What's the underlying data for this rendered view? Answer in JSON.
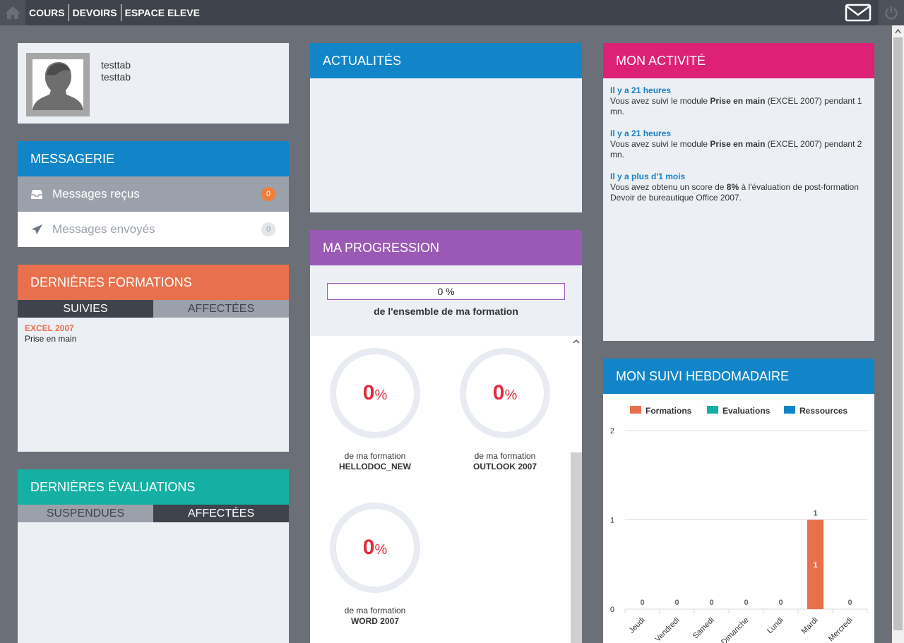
{
  "nav": {
    "items": [
      "COURS",
      "DEVOIRS",
      "ESPACE ELEVE"
    ]
  },
  "profile": {
    "line1": "testtab",
    "line2": "testtab"
  },
  "messagerie": {
    "title": "MESSAGERIE",
    "received_label": "Messages reçus",
    "received_count": "0",
    "sent_label": "Messages envoyés",
    "sent_count": "0"
  },
  "formations": {
    "title": "DERNIÈRES FORMATIONS",
    "tabs": [
      "SUIVIES",
      "AFFECTÉES"
    ],
    "items": [
      {
        "title": "EXCEL 2007",
        "sub": "Prise en main"
      }
    ]
  },
  "evaluations": {
    "title": "DERNIÈRES ÉVALUATIONS",
    "tabs": [
      "SUSPENDUES",
      "AFFECTÉES"
    ]
  },
  "actualites": {
    "title": "ACTUALITÉS"
  },
  "progression": {
    "title": "MA PROGRESSION",
    "overall": "0 %",
    "overall_caption": "de l'ensemble de ma formation",
    "courses": [
      {
        "pct": "0",
        "unit": "%",
        "caption": "de ma formation",
        "name": "HELLODOC_NEW"
      },
      {
        "pct": "0",
        "unit": "%",
        "caption": "de ma formation",
        "name": "OUTLOOK 2007"
      },
      {
        "pct": "0",
        "unit": "%",
        "caption": "de ma formation",
        "name": "WORD 2007"
      }
    ]
  },
  "activite": {
    "title": "MON ACTIVITÉ",
    "items": [
      {
        "time": "Il y a 21 heures",
        "pre": "Vous avez suivi le module ",
        "bold": "Prise en main",
        "post": " (EXCEL 2007) pendant 1 mn."
      },
      {
        "time": "Il y a 21 heures",
        "pre": "Vous avez suivi le module ",
        "bold": "Prise en main",
        "post": " (EXCEL 2007) pendant 2 mn."
      },
      {
        "time": "Il y a plus d'1 mois",
        "pre": "Vous avez obtenu un score de ",
        "bold": "8%",
        "post": " à l'évaluation de post-formation Devoir de bureautique Office 2007."
      }
    ]
  },
  "suivi": {
    "title": "MON SUIVI HEBDOMADAIRE"
  },
  "colors": {
    "blue": "#1285c8",
    "orange": "#e8704d",
    "purple": "#9b59b6",
    "pink": "#dc2177",
    "teal": "#15b0a3"
  },
  "chart_data": {
    "type": "bar",
    "categories": [
      "Jeudi",
      "Vendredi",
      "Samedi",
      "Dimanche",
      "Lundi",
      "Mardi",
      "Mercredi"
    ],
    "series": [
      {
        "name": "Formations",
        "color": "#e8704d",
        "values": [
          0,
          0,
          0,
          0,
          0,
          1,
          0
        ]
      },
      {
        "name": "Evaluations",
        "color": "#15b0a3",
        "values": [
          0,
          0,
          0,
          0,
          0,
          0,
          0
        ]
      },
      {
        "name": "Ressources",
        "color": "#1285c8",
        "values": [
          0,
          0,
          0,
          0,
          0,
          0,
          0
        ]
      }
    ],
    "yticks": [
      0,
      1,
      2
    ],
    "ylim": [
      0,
      2
    ],
    "legend": "top",
    "grid": true
  }
}
